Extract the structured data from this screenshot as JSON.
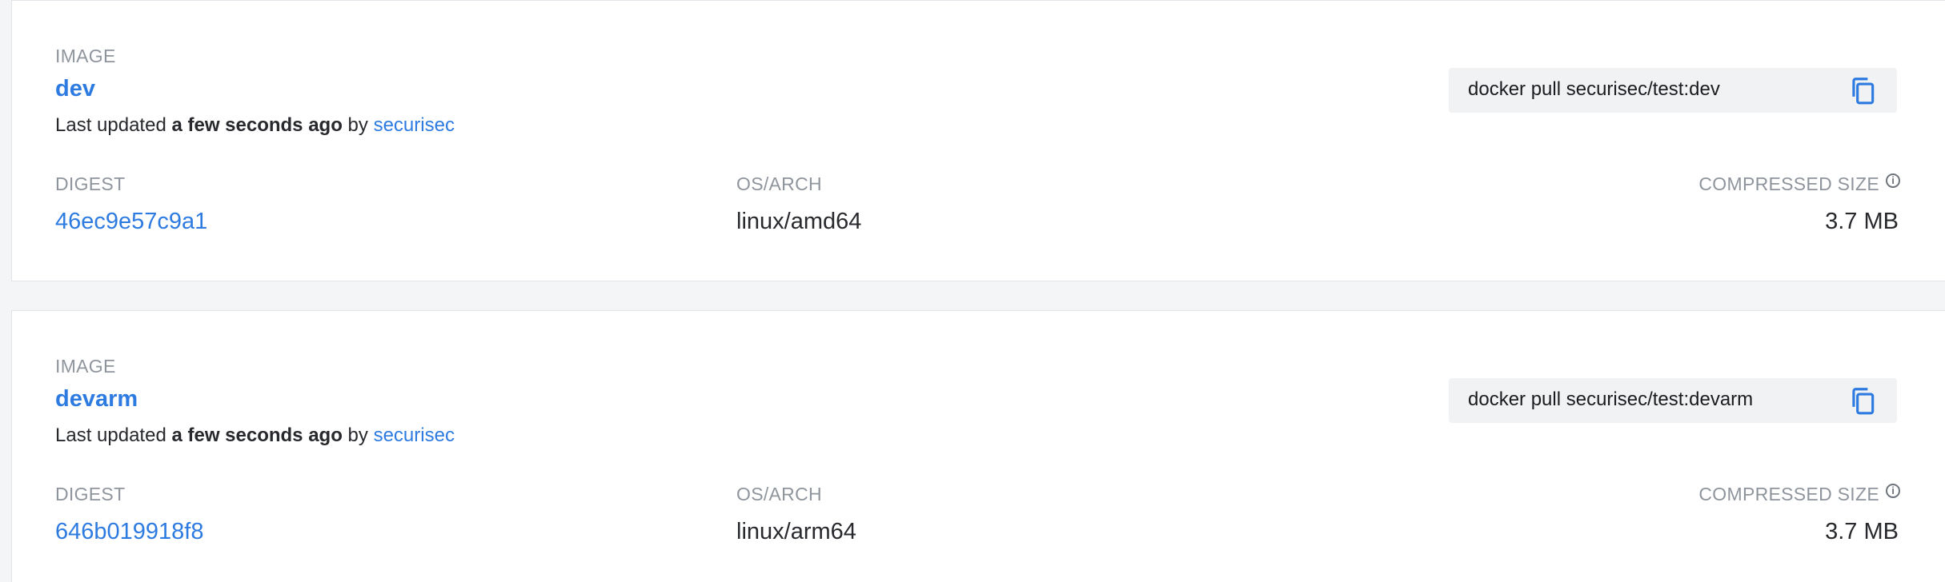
{
  "images": [
    {
      "section_label": "IMAGE",
      "tag": "dev",
      "updated_prefix": "Last updated",
      "updated_time": "a few seconds ago",
      "updated_by_word": "by",
      "user": "securisec",
      "pull_command": "docker pull securisec/test:dev",
      "digest_label": "DIGEST",
      "digest": "46ec9e57c9a1",
      "osarch_label": "OS/ARCH",
      "osarch": "linux/amd64",
      "size_label": "COMPRESSED SIZE",
      "size": "3.7 MB"
    },
    {
      "section_label": "IMAGE",
      "tag": "devarm",
      "updated_prefix": "Last updated",
      "updated_time": "a few seconds ago",
      "updated_by_word": "by",
      "user": "securisec",
      "pull_command": "docker pull securisec/test:devarm",
      "digest_label": "DIGEST",
      "digest": "646b019918f8",
      "osarch_label": "OS/ARCH",
      "osarch": "linux/arm64",
      "size_label": "COMPRESSED SIZE",
      "size": "3.7 MB"
    }
  ],
  "icons": {
    "copy": "copy-icon",
    "info": "info-icon"
  },
  "colors": {
    "link": "#2d7be0",
    "muted_label": "#8f959c",
    "background": "#f4f5f7"
  }
}
